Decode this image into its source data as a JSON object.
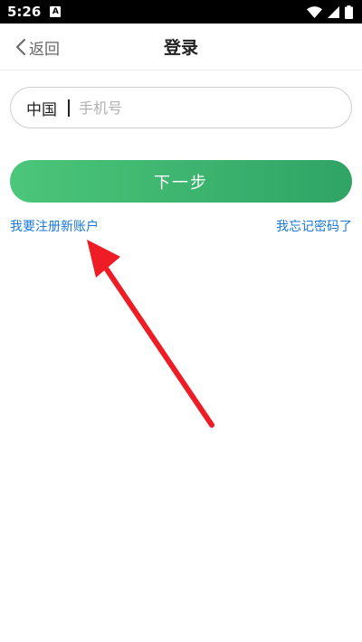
{
  "status_bar": {
    "time": "5:26",
    "notification_glyph": "A",
    "icons": [
      "wifi-icon",
      "signal-icon",
      "battery-icon"
    ]
  },
  "header": {
    "back_label": "返回",
    "title": "登录"
  },
  "login_form": {
    "country": "中国",
    "phone_value": "",
    "phone_placeholder": "手机号",
    "next_label": "下一步"
  },
  "links": {
    "register": "我要注册新账户",
    "forgot_password": "我忘记密码了"
  },
  "colors": {
    "accent_start": "#4cc67a",
    "accent_end": "#2fa465",
    "link": "#1a78d6",
    "annotation_arrow": "#ee1c25"
  }
}
